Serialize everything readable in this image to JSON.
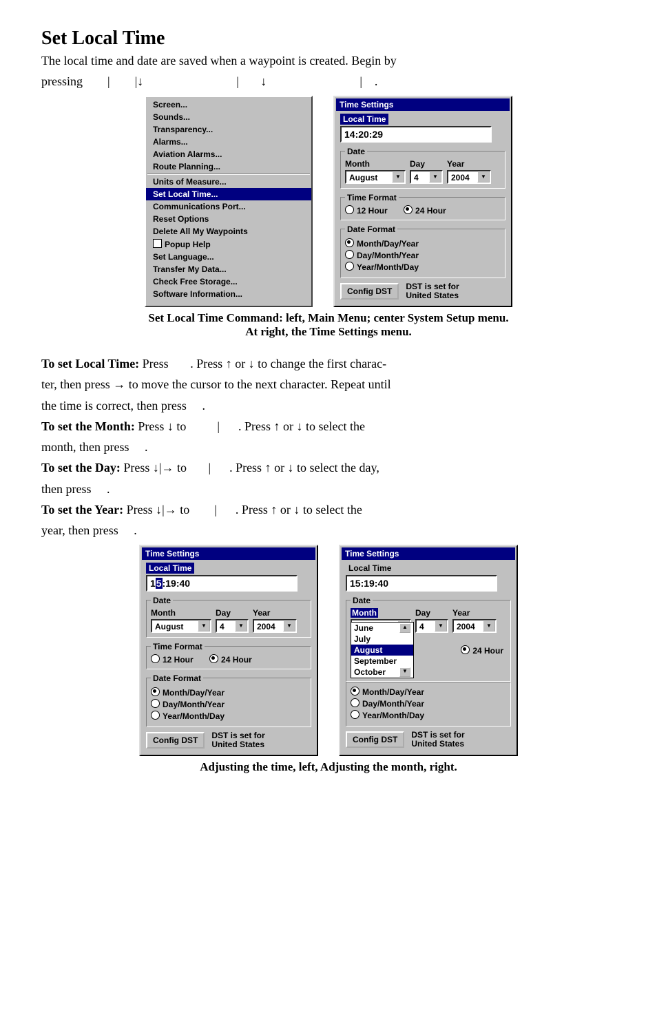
{
  "heading": "Set Local Time",
  "intro_line1": "The local time and date are saved when a waypoint is created. Begin by",
  "intro_line2": "pressing",
  "menu": {
    "items_top": [
      "Screen...",
      "Sounds...",
      "Transparency...",
      "Alarms...",
      "Aviation Alarms...",
      "Route Planning..."
    ],
    "items_mid_pre": "Units of Measure...",
    "selected": "Set Local Time...",
    "items_mid_post": [
      "Communications Port...",
      "Reset Options",
      "Delete All My Waypoints"
    ],
    "popup_help": "Popup Help",
    "items_bottom": [
      "Set Language...",
      "Transfer My Data...",
      "Check Free Storage...",
      "Software Information..."
    ]
  },
  "dlg1": {
    "title": "Time Settings",
    "local_time_label": "Local Time",
    "local_time_value": "14:20:29",
    "date_legend": "Date",
    "month_label": "Month",
    "day_label": "Day",
    "year_label": "Year",
    "month_value": "August",
    "day_value": "4",
    "year_value": "2004",
    "time_format_legend": "Time Format",
    "tf_12": "12 Hour",
    "tf_24": "24 Hour",
    "date_format_legend": "Date Format",
    "df_mdy": "Month/Day/Year",
    "df_dmy": "Day/Month/Year",
    "df_ymd": "Year/Month/Day",
    "config_btn": "Config DST",
    "dst_line1": "DST is set for",
    "dst_line2": "United States"
  },
  "caption1a": "Set Local Time Command: left, Main Menu; center System Setup menu.",
  "caption1b": "At right, the Time Settings menu.",
  "para_localtime_1": "To set Local Time:",
  "para_localtime_2": "Press",
  "para_localtime_3": ". Press ↑ or ↓ to change the first charac-",
  "para_localtime_4": "ter, then press → to move the cursor to the next character. Repeat until",
  "para_localtime_5": "the time is correct, then press",
  "para_month_1": "To set the Month:",
  "para_month_2": "Press ↓ to",
  "para_month_3": ". Press ↑ or ↓ to select the",
  "para_month_4": "month, then press",
  "para_day_1": "To set the Day:",
  "para_day_2": "Press ↓|→ to",
  "para_day_3": ". Press ↑ or ↓ to select the day,",
  "para_day_4": "then press",
  "para_year_1": "To set the Year:",
  "para_year_2": "Press ↓|→ to",
  "para_year_3": ". Press ↑ or ↓ to select the",
  "para_year_4": "year, then press",
  "dlg2": {
    "title": "Time Settings",
    "local_time_label": "Local Time",
    "lt_prefix": "1",
    "lt_hl": "5",
    "lt_suffix": ":19:40",
    "month_value": "August",
    "day_value": "4",
    "year_value": "2004"
  },
  "dlg3": {
    "title": "Time Settings",
    "local_time_label": "Local Time",
    "local_time_value": "15:19:40",
    "month_sel": "Month",
    "month_value": "August",
    "day_value": "4",
    "year_value": "2004",
    "dropdown": [
      "June",
      "July",
      "August",
      "September",
      "October"
    ],
    "dropdown_selected": "August"
  },
  "caption2": "Adjusting the time, left, Adjusting the month, right."
}
